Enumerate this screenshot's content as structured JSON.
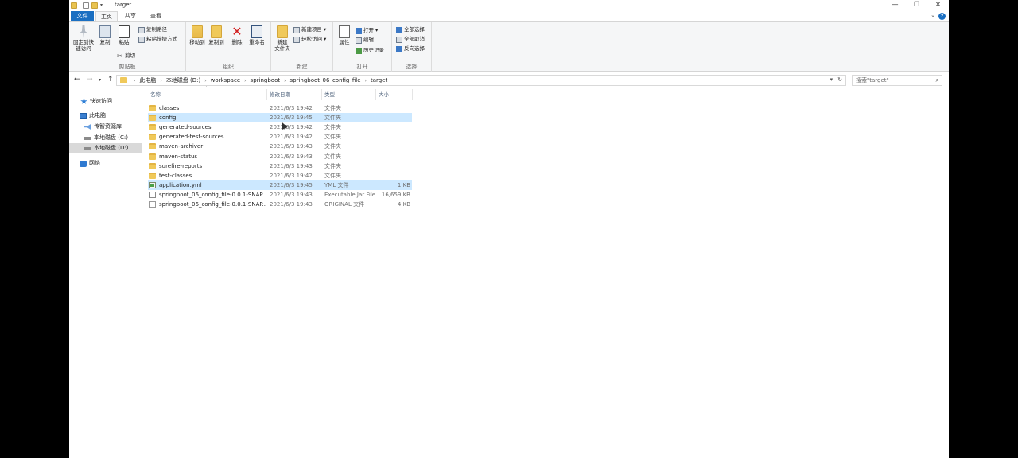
{
  "window": {
    "title": "target",
    "controls": {
      "minimize": "—",
      "maximize": "❐",
      "close": "✕"
    }
  },
  "tabs": {
    "file": "文件",
    "home": "主页",
    "share": "共享",
    "view": "查看"
  },
  "ribbon": {
    "clipboard": {
      "label": "剪贴板",
      "pin": "固定到快速访问",
      "copy": "复制",
      "paste": "粘贴",
      "copy_path": "复制路径",
      "paste_shortcut": "粘贴快捷方式",
      "cut": "剪切"
    },
    "organize": {
      "label": "组织",
      "move_to": "移动到",
      "copy_to": "复制到",
      "delete": "删除",
      "rename": "重命名"
    },
    "new": {
      "label": "新建",
      "new_folder": "新建\n文件夹",
      "new_item": "新建项目",
      "easy_access": "轻松访问"
    },
    "open": {
      "label": "打开",
      "properties": "属性",
      "open": "打开",
      "edit": "编辑",
      "history": "历史记录"
    },
    "select": {
      "label": "选择",
      "select_all": "全部选择",
      "select_none": "全部取消",
      "invert": "反向选择"
    }
  },
  "address": {
    "crumbs": [
      "此电脑",
      "本地磁盘 (D:)",
      "workspace",
      "springboot",
      "springboot_06_config_file",
      "target"
    ],
    "search_placeholder": "搜索\"target\""
  },
  "nav": {
    "quick_access": "快速访问",
    "this_pc": "此电脑",
    "media": "传智资源库",
    "drive_c": "本地磁盘 (C:)",
    "drive_d": "本地磁盘 (D:)",
    "network": "网络"
  },
  "columns": {
    "name": "名称",
    "date": "修改日期",
    "type": "类型",
    "size": "大小"
  },
  "files": [
    {
      "name": "classes",
      "date": "2021/6/3 19:42",
      "type": "文件夹",
      "size": "",
      "icon": "folder"
    },
    {
      "name": "config",
      "date": "2021/6/3 19:45",
      "type": "文件夹",
      "size": "",
      "icon": "folder"
    },
    {
      "name": "generated-sources",
      "date": "2021/6/3 19:42",
      "type": "文件夹",
      "size": "",
      "icon": "folder"
    },
    {
      "name": "generated-test-sources",
      "date": "2021/6/3 19:42",
      "type": "文件夹",
      "size": "",
      "icon": "folder"
    },
    {
      "name": "maven-archiver",
      "date": "2021/6/3 19:43",
      "type": "文件夹",
      "size": "",
      "icon": "folder"
    },
    {
      "name": "maven-status",
      "date": "2021/6/3 19:43",
      "type": "文件夹",
      "size": "",
      "icon": "folder"
    },
    {
      "name": "surefire-reports",
      "date": "2021/6/3 19:43",
      "type": "文件夹",
      "size": "",
      "icon": "folder"
    },
    {
      "name": "test-classes",
      "date": "2021/6/3 19:42",
      "type": "文件夹",
      "size": "",
      "icon": "folder"
    },
    {
      "name": "application.yml",
      "date": "2021/6/3 19:45",
      "type": "YML 文件",
      "size": "1 KB",
      "icon": "yml"
    },
    {
      "name": "springboot_06_config_file-0.0.1-SNAP...",
      "date": "2021/6/3 19:43",
      "type": "Executable Jar File",
      "size": "16,659 KB",
      "icon": "jar"
    },
    {
      "name": "springboot_06_config_file-0.0.1-SNAP...",
      "date": "2021/6/3 19:43",
      "type": "ORIGINAL 文件",
      "size": "4 KB",
      "icon": "file"
    }
  ]
}
